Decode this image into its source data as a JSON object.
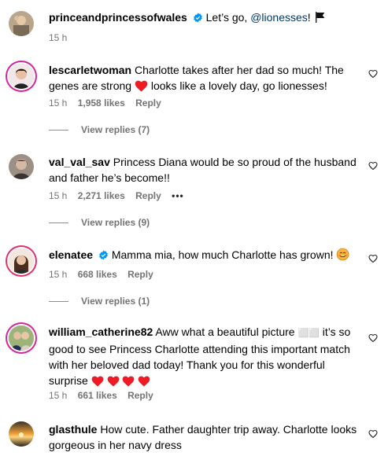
{
  "caption": {
    "username": "princeandprincessofwales",
    "text": "Let’s go,",
    "mention": "@lionesses",
    "suffix": "!",
    "time": "15 h"
  },
  "comments": [
    {
      "username": "lescarletwoman",
      "text_1": "Charlotte takes after her dad so much! The genes are strong",
      "text_2": "looks like a lovely day, go lionesses!",
      "time": "15 h",
      "likes": "1,958 likes",
      "reply": "Reply",
      "view_replies": "View replies (7)"
    },
    {
      "username": "val_val_sav",
      "text_1": "Princess Diana would be so proud of the husband and father he’s become!!",
      "time": "15 h",
      "likes": "2,271 likes",
      "reply": "Reply",
      "more": "•••",
      "view_replies": "View replies (9)"
    },
    {
      "username": "elenatee",
      "text_1": "Mamma mia, how much Charlotte has grown!",
      "time": "15 h",
      "likes": "668 likes",
      "reply": "Reply",
      "view_replies": "View replies (1)"
    },
    {
      "username": "william_catherine82",
      "text_1": "Aww what a beautiful picture",
      "text_glyphs": "⬜⬜",
      "text_2": "it’s so good to see Princess Charlotte attending this important match with her beloved dad today! Thank you for this wonderful surprise",
      "time": "15 h",
      "likes": "661 likes",
      "reply": "Reply"
    },
    {
      "username": "glasthule",
      "text_1": "How cute. Father daughter trip away. Charlotte looks gorgeous in her navy dress"
    }
  ],
  "colors": {
    "verified": "#0095f6",
    "heart": "#ed1c24",
    "meta": "#737373",
    "mention": "#00376b"
  },
  "icons": [
    "verified-badge-icon",
    "flag-icon",
    "heart-outline-icon",
    "heart-red-emoji-icon",
    "smiling-face-emoji-icon"
  ]
}
